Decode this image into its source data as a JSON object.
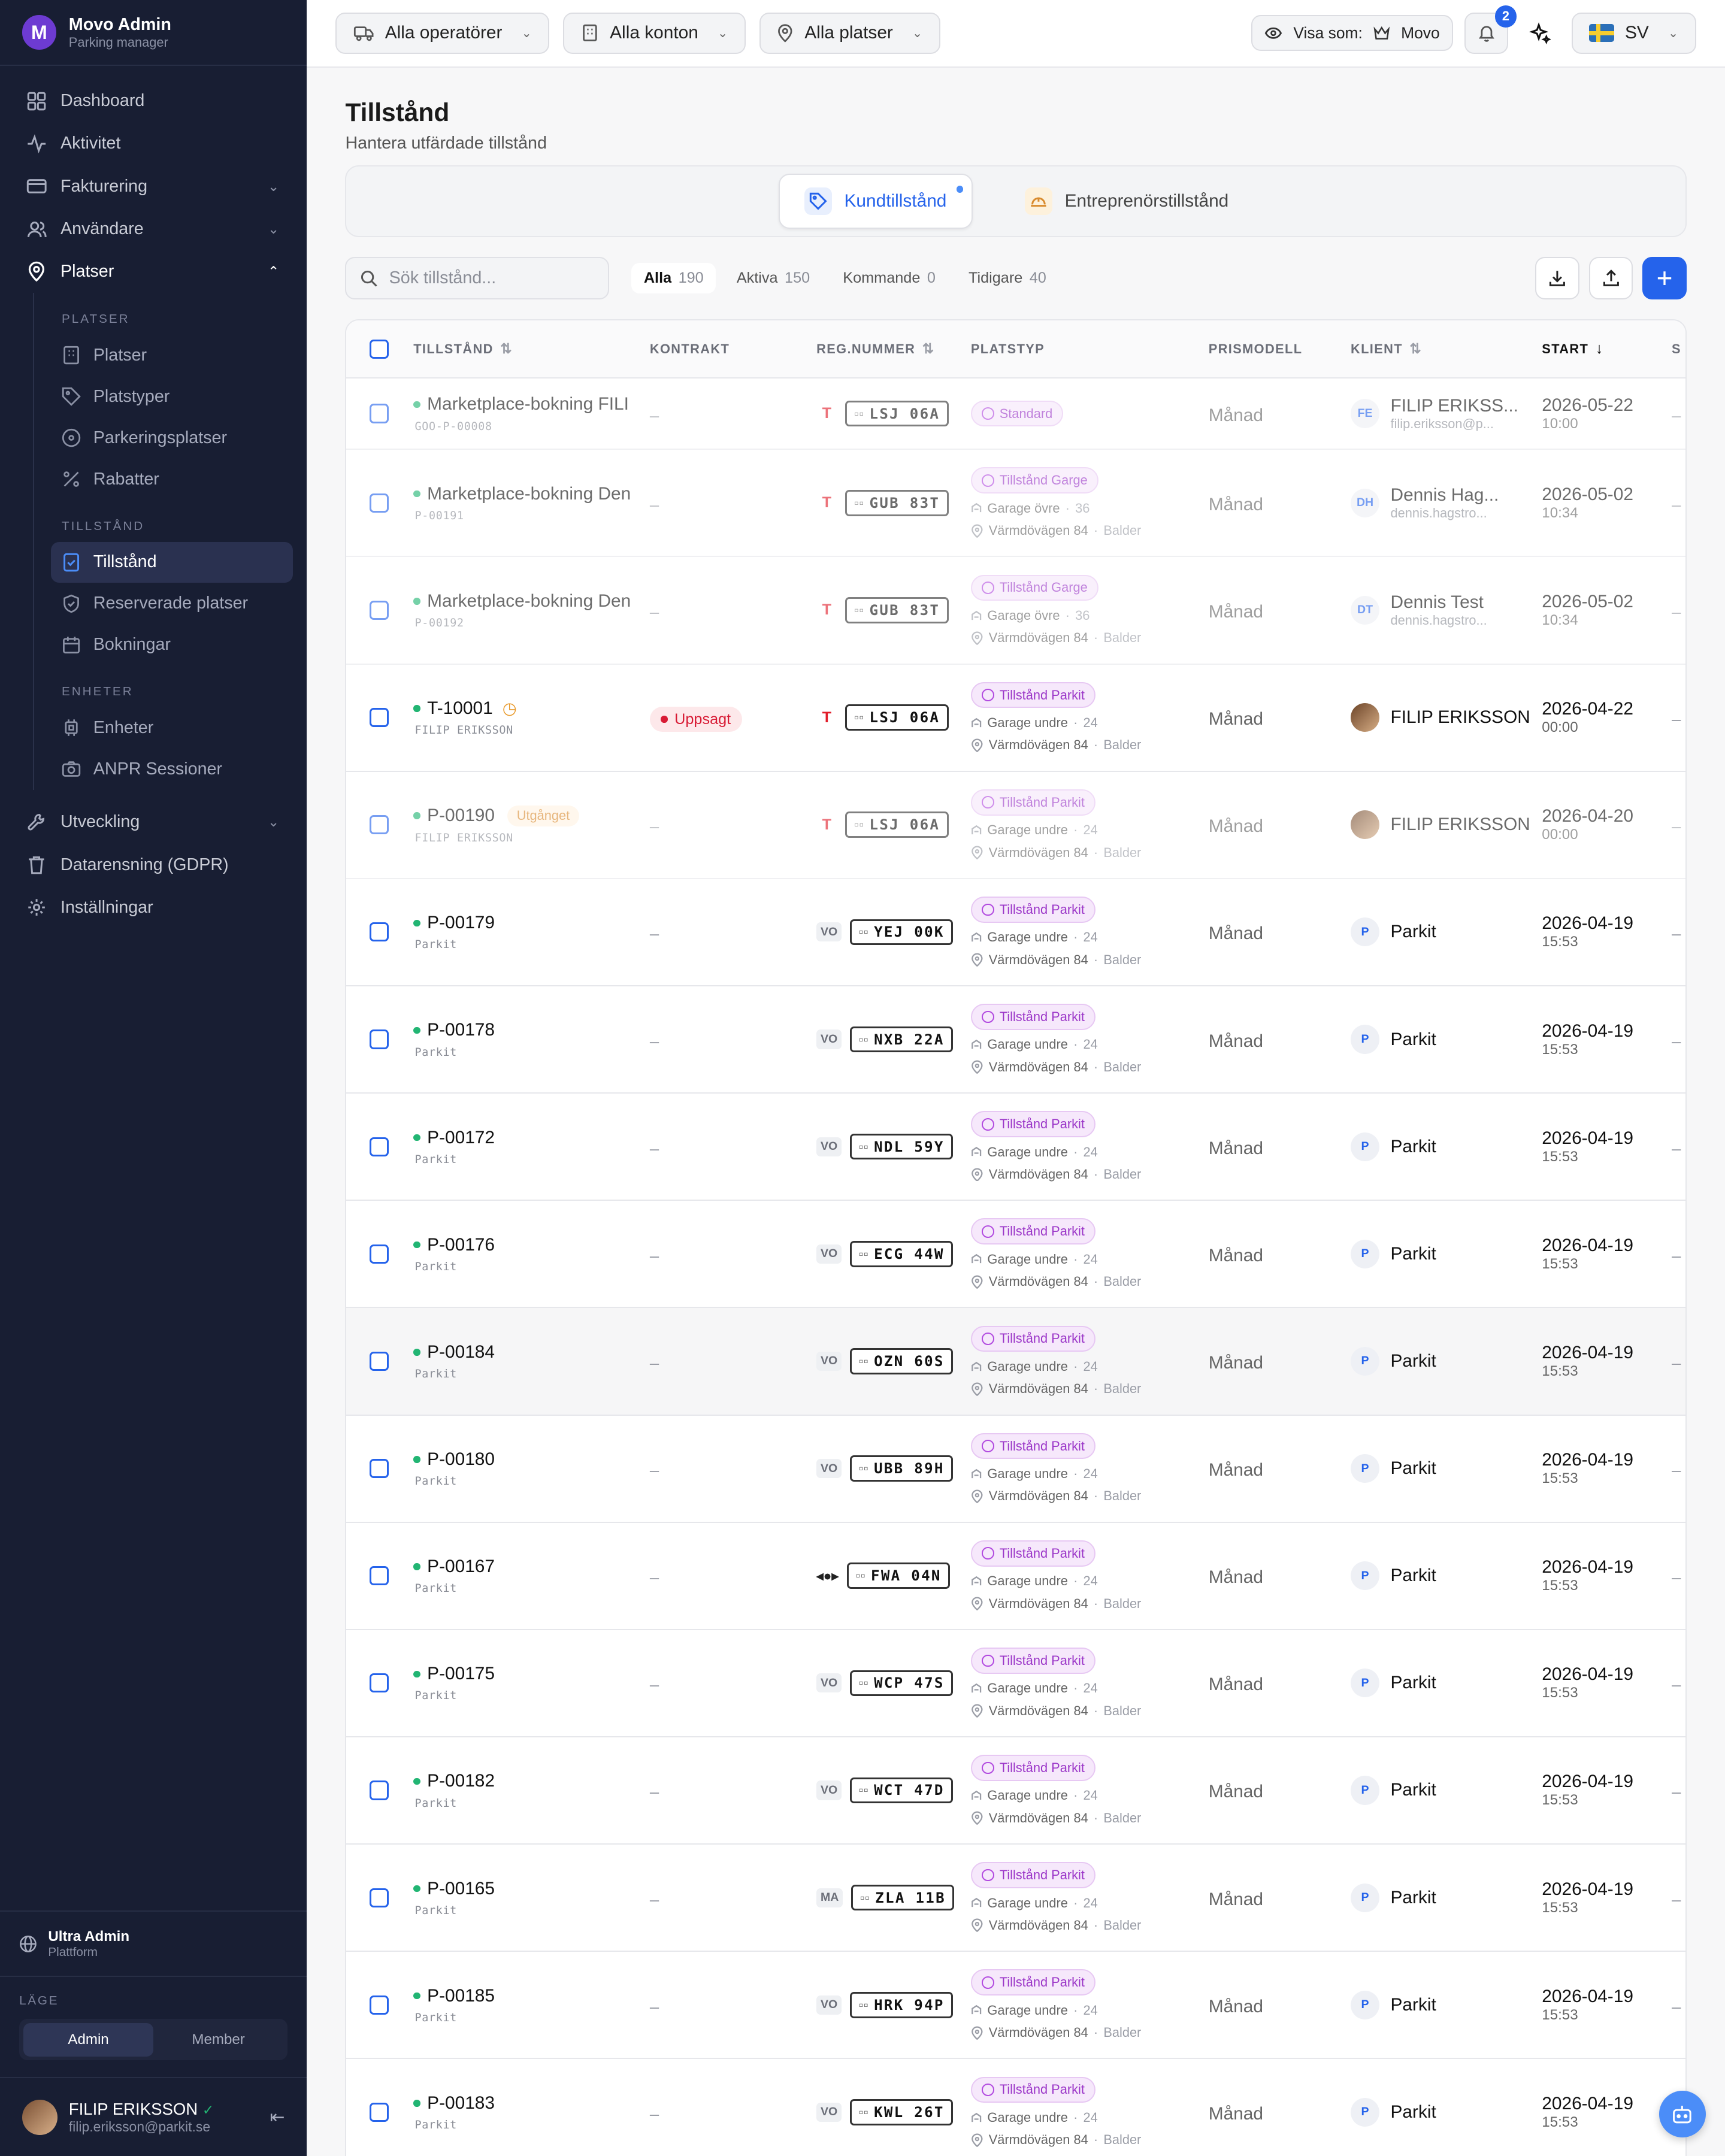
{
  "app": {
    "name": "Movo Admin",
    "subtitle": "Parking manager"
  },
  "sidebar": {
    "items": [
      {
        "label": "Dashboard",
        "icon": "grid-icon"
      },
      {
        "label": "Aktivitet",
        "icon": "activity-icon"
      },
      {
        "label": "Fakturering",
        "icon": "card-icon",
        "expandable": true
      },
      {
        "label": "Användare",
        "icon": "users-icon",
        "expandable": true
      },
      {
        "label": "Platser",
        "icon": "pin-icon",
        "expanded": true
      }
    ],
    "section_platser": "PLATSER",
    "platser_items": [
      "Platser",
      "Platstyper",
      "Parkeringsplatser",
      "Rabatter"
    ],
    "section_tillstand": "TILLSTÅND",
    "tillstand_items": [
      "Tillstånd",
      "Reserverade platser",
      "Bokningar"
    ],
    "section_enheter": "ENHETER",
    "enheter_items": [
      "Enheter",
      "ANPR Sessioner"
    ],
    "bottom_items": [
      "Utveckling",
      "Datarensning (GDPR)",
      "Inställningar"
    ],
    "role": {
      "title": "Ultra Admin",
      "subtitle": "Plattform"
    },
    "mode_label": "LÄGE",
    "mode_options": [
      "Admin",
      "Member"
    ],
    "user": {
      "name": "FILIP ERIKSSON",
      "email": "filip.eriksson@parkit.se"
    }
  },
  "topbar": {
    "operators": "Alla operatörer",
    "accounts": "Alla konton",
    "places": "Alla platser",
    "view_as_label": "Visa som:",
    "view_as_value": "Movo",
    "notifications": "2",
    "language": "SV"
  },
  "page": {
    "title": "Tillstånd",
    "subtitle": "Hantera utfärdade tillstånd",
    "tabs": [
      "Kundtillstånd",
      "Entreprenörstillstånd"
    ],
    "search_placeholder": "Sök tillstånd...",
    "filters": [
      {
        "label": "Alla",
        "count": "190"
      },
      {
        "label": "Aktiva",
        "count": "150"
      },
      {
        "label": "Kommande",
        "count": "0"
      },
      {
        "label": "Tidigare",
        "count": "40"
      }
    ]
  },
  "table": {
    "columns": [
      "TILLSTÅND",
      "KONTRAKT",
      "REG.NUMMER",
      "PLATSTYP",
      "PRISMODELL",
      "KLIENT",
      "START"
    ],
    "rows": [
      {
        "title": "Marketplace-bokning FILI",
        "sub": "GOO-P-00008",
        "contract": "–",
        "make": "T",
        "plate": "LSJ 06A",
        "type": "Standard",
        "garage": "",
        "gcount": "",
        "addr": "",
        "area": "",
        "price": "Månad",
        "client": "FILIP ERIKSS...",
        "email": "filip.eriksson@p...",
        "initials": "FE",
        "date": "2026-05-22",
        "time": "10:00",
        "dim": true,
        "short": true
      },
      {
        "title": "Marketplace-bokning Den",
        "sub": "P-00191",
        "contract": "–",
        "make": "T",
        "plate": "GUB 83T",
        "type": "Tillstånd Garge",
        "garage": "Garage övre",
        "gcount": "36",
        "addr": "Värmdövägen 84",
        "area": "Balder",
        "price": "Månad",
        "client": "Dennis Hag...",
        "email": "dennis.hagstro...",
        "initials": "DH",
        "date": "2026-05-02",
        "time": "10:34",
        "dim": true
      },
      {
        "title": "Marketplace-bokning Den",
        "sub": "P-00192",
        "contract": "–",
        "make": "T",
        "plate": "GUB 83T",
        "type": "Tillstånd Garge",
        "garage": "Garage övre",
        "gcount": "36",
        "addr": "Värmdövägen 84",
        "area": "Balder",
        "price": "Månad",
        "client": "Dennis Test",
        "email": "dennis.hagstro...",
        "initials": "DT",
        "date": "2026-05-02",
        "time": "10:34",
        "dim": true
      },
      {
        "title": "T-10001",
        "sub": "FILIP ERIKSSON",
        "contract": "Uppsagt",
        "make": "T",
        "plate": "LSJ 06A",
        "type": "Tillstånd Parkit",
        "garage": "Garage undre",
        "gcount": "24",
        "addr": "Värmdövägen 84",
        "area": "Balder",
        "price": "Månad",
        "client": "FILIP ERIKSSON",
        "email": "",
        "initials": "",
        "date": "2026-04-22",
        "time": "00:00",
        "clock": true,
        "photo": true
      },
      {
        "title": "P-00190",
        "sub": "FILIP ERIKSSON",
        "contract": "–",
        "make": "T",
        "plate": "LSJ 06A",
        "type": "Tillstånd Parkit",
        "garage": "Garage undre",
        "gcount": "24",
        "addr": "Värmdövägen 84",
        "area": "Balder",
        "price": "Månad",
        "client": "FILIP ERIKSSON",
        "email": "",
        "initials": "",
        "date": "2026-04-20",
        "time": "00:00",
        "expired": "Utgånget",
        "photo": true,
        "dim": true
      },
      {
        "title": "P-00179",
        "sub": "Parkit",
        "contract": "–",
        "make": "VO",
        "plate": "YEJ 00K",
        "type": "Tillstånd Parkit",
        "garage": "Garage undre",
        "gcount": "24",
        "addr": "Värmdövägen 84",
        "area": "Balder",
        "price": "Månad",
        "client": "Parkit",
        "email": "",
        "initials": "P",
        "date": "2026-04-19",
        "time": "15:53"
      },
      {
        "title": "P-00178",
        "sub": "Parkit",
        "contract": "–",
        "make": "VO",
        "plate": "NXB 22A",
        "type": "Tillstånd Parkit",
        "garage": "Garage undre",
        "gcount": "24",
        "addr": "Värmdövägen 84",
        "area": "Balder",
        "price": "Månad",
        "client": "Parkit",
        "email": "",
        "initials": "P",
        "date": "2026-04-19",
        "time": "15:53"
      },
      {
        "title": "P-00172",
        "sub": "Parkit",
        "contract": "–",
        "make": "VO",
        "plate": "NDL 59Y",
        "type": "Tillstånd Parkit",
        "garage": "Garage undre",
        "gcount": "24",
        "addr": "Värmdövägen 84",
        "area": "Balder",
        "price": "Månad",
        "client": "Parkit",
        "email": "",
        "initials": "P",
        "date": "2026-04-19",
        "time": "15:53"
      },
      {
        "title": "P-00176",
        "sub": "Parkit",
        "contract": "–",
        "make": "VO",
        "plate": "ECG 44W",
        "type": "Tillstånd Parkit",
        "garage": "Garage undre",
        "gcount": "24",
        "addr": "Värmdövägen 84",
        "area": "Balder",
        "price": "Månad",
        "client": "Parkit",
        "email": "",
        "initials": "P",
        "date": "2026-04-19",
        "time": "15:53"
      },
      {
        "title": "P-00184",
        "sub": "Parkit",
        "contract": "–",
        "make": "VO",
        "plate": "OZN 60S",
        "type": "Tillstånd Parkit",
        "garage": "Garage undre",
        "gcount": "24",
        "addr": "Värmdövägen 84",
        "area": "Balder",
        "price": "Månad",
        "client": "Parkit",
        "email": "",
        "initials": "P",
        "date": "2026-04-19",
        "time": "15:53",
        "hl": true
      },
      {
        "title": "P-00180",
        "sub": "Parkit",
        "contract": "–",
        "make": "VO",
        "plate": "UBB 89H",
        "type": "Tillstånd Parkit",
        "garage": "Garage undre",
        "gcount": "24",
        "addr": "Värmdövägen 84",
        "area": "Balder",
        "price": "Månad",
        "client": "Parkit",
        "email": "",
        "initials": "P",
        "date": "2026-04-19",
        "time": "15:53"
      },
      {
        "title": "P-00167",
        "sub": "Parkit",
        "contract": "–",
        "make": "MINI",
        "plate": "FWA 04N",
        "type": "Tillstånd Parkit",
        "garage": "Garage undre",
        "gcount": "24",
        "addr": "Värmdövägen 84",
        "area": "Balder",
        "price": "Månad",
        "client": "Parkit",
        "email": "",
        "initials": "P",
        "date": "2026-04-19",
        "time": "15:53"
      },
      {
        "title": "P-00175",
        "sub": "Parkit",
        "contract": "–",
        "make": "VO",
        "plate": "WCP 47S",
        "type": "Tillstånd Parkit",
        "garage": "Garage undre",
        "gcount": "24",
        "addr": "Värmdövägen 84",
        "area": "Balder",
        "price": "Månad",
        "client": "Parkit",
        "email": "",
        "initials": "P",
        "date": "2026-04-19",
        "time": "15:53"
      },
      {
        "title": "P-00182",
        "sub": "Parkit",
        "contract": "–",
        "make": "VO",
        "plate": "WCT 47D",
        "type": "Tillstånd Parkit",
        "garage": "Garage undre",
        "gcount": "24",
        "addr": "Värmdövägen 84",
        "area": "Balder",
        "price": "Månad",
        "client": "Parkit",
        "email": "",
        "initials": "P",
        "date": "2026-04-19",
        "time": "15:53"
      },
      {
        "title": "P-00165",
        "sub": "Parkit",
        "contract": "–",
        "make": "MA",
        "plate": "ZLA 11B",
        "type": "Tillstånd Parkit",
        "garage": "Garage undre",
        "gcount": "24",
        "addr": "Värmdövägen 84",
        "area": "Balder",
        "price": "Månad",
        "client": "Parkit",
        "email": "",
        "initials": "P",
        "date": "2026-04-19",
        "time": "15:53"
      },
      {
        "title": "P-00185",
        "sub": "Parkit",
        "contract": "–",
        "make": "VO",
        "plate": "HRK 94P",
        "type": "Tillstånd Parkit",
        "garage": "Garage undre",
        "gcount": "24",
        "addr": "Värmdövägen 84",
        "area": "Balder",
        "price": "Månad",
        "client": "Parkit",
        "email": "",
        "initials": "P",
        "date": "2026-04-19",
        "time": "15:53"
      },
      {
        "title": "P-00183",
        "sub": "Parkit",
        "contract": "–",
        "make": "VO",
        "plate": "KWL 26T",
        "type": "Tillstånd Parkit",
        "garage": "Garage undre",
        "gcount": "24",
        "addr": "Värmdövägen 84",
        "area": "Balder",
        "price": "Månad",
        "client": "Parkit",
        "email": "",
        "initials": "P",
        "date": "2026-04-19",
        "time": "15:53"
      }
    ]
  },
  "colors": {
    "accent": "#2563eb",
    "sidebar": "#181e33",
    "active_green": "#22b573",
    "permit_purple": "#9b36c8",
    "cancelled_red": "#d81b35"
  }
}
